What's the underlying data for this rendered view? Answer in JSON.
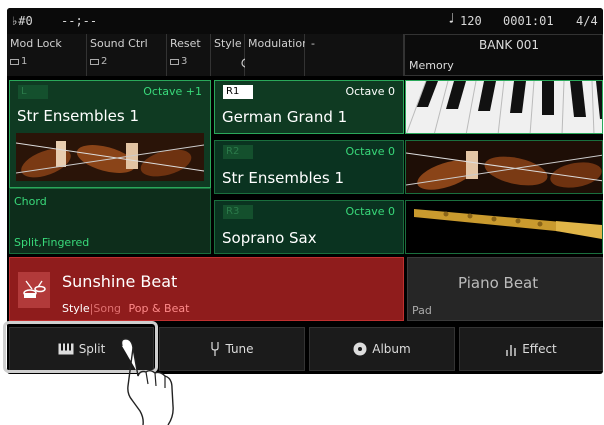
{
  "status": {
    "left_icon": "♭#0",
    "left_time": "--;--",
    "tempo_icon": "♩",
    "tempo": "120",
    "measure": "0001:01",
    "beat": "4/4"
  },
  "controls": [
    {
      "label": "Mod Lock",
      "num": "1",
      "icon": "square-icon"
    },
    {
      "label": "Sound Ctrl",
      "num": "2",
      "icon": "square-icon"
    },
    {
      "label": "Reset",
      "num": "3",
      "icon": "square-icon"
    },
    {
      "label": "Style",
      "num": "",
      "icon": "knob-icon"
    },
    {
      "label": "Modulation",
      "num": "",
      "icon": "light-icon"
    },
    {
      "label": "-",
      "num": "",
      "icon": ""
    }
  ],
  "bank": {
    "title": "BANK 001",
    "memory": "Memory"
  },
  "voices": {
    "left": {
      "tag": "L",
      "octave": "Octave +1",
      "name": "Str Ensembles 1",
      "image": "violin-section-image"
    },
    "r1": {
      "tag": "R1",
      "octave": "Octave 0",
      "name": "German Grand 1",
      "image": "piano-keys-image"
    },
    "r2": {
      "tag": "R2",
      "octave": "Octave 0",
      "name": "Str Ensembles 1",
      "image": "violin-section-image"
    },
    "r3": {
      "tag": "R3",
      "octave": "Octave 0",
      "name": "Soprano Sax",
      "image": "saxophone-image"
    }
  },
  "chord": {
    "title": "Chord",
    "mode": "Split,Fingered"
  },
  "style": {
    "name": "Sunshine Beat",
    "tab_style": "Style",
    "separator": "|",
    "tab_song": "Song",
    "category": "Pop & Beat",
    "icon": "drums-icon"
  },
  "pad": {
    "name": "Piano Beat",
    "label": "Pad"
  },
  "buttons": [
    {
      "label": "Split",
      "icon": "keyboard-icon"
    },
    {
      "label": "Tune",
      "icon": "tuning-fork-icon"
    },
    {
      "label": "Album",
      "icon": "disc-icon"
    },
    {
      "label": "Effect",
      "icon": "equalizer-icon"
    }
  ],
  "colors": {
    "voice_green": "#0f3a22",
    "voice_border": "#2aa85a",
    "style_red": "#8f1c1c",
    "octave_green": "#39d97a"
  }
}
